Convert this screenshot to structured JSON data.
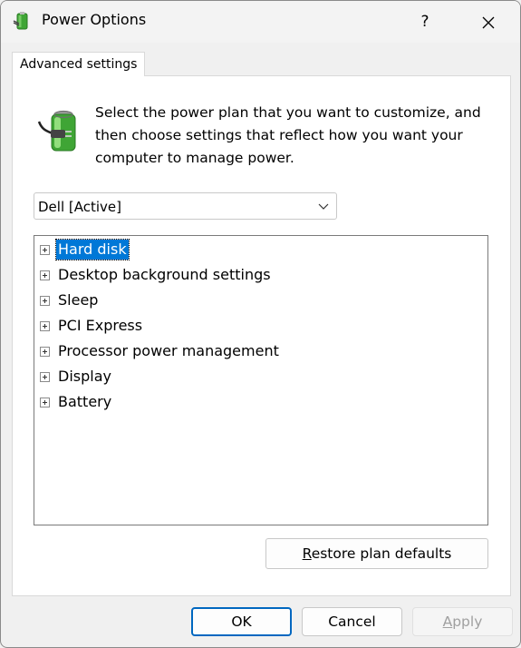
{
  "window": {
    "title": "Power Options",
    "help_label": "?"
  },
  "tabs": [
    {
      "label": "Advanced settings"
    }
  ],
  "description": "Select the power plan that you want to customize, and then choose settings that reflect how you want your computer to manage power.",
  "plan_select": {
    "value": "Dell [Active]"
  },
  "tree": {
    "items": [
      {
        "label": "Hard disk",
        "selected": true
      },
      {
        "label": "Desktop background settings"
      },
      {
        "label": "Sleep"
      },
      {
        "label": "PCI Express"
      },
      {
        "label": "Processor power management"
      },
      {
        "label": "Display"
      },
      {
        "label": "Battery"
      }
    ]
  },
  "buttons": {
    "restore_pre": "R",
    "restore_rest": "estore plan defaults",
    "ok": "OK",
    "cancel": "Cancel",
    "apply_pre": "A",
    "apply_rest": "pply"
  },
  "colors": {
    "selection": "#0078d7",
    "ok_border": "#0067c0",
    "battery_green": "#3fa535"
  },
  "icons": [
    "power-options-icon",
    "help-icon",
    "close-icon",
    "battery-plug-icon",
    "chevron-down-icon",
    "expand-plus-icon"
  ]
}
